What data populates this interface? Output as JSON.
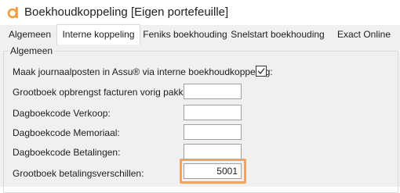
{
  "window": {
    "title": "Boekhoudkoppeling [Eigen portefeuille]"
  },
  "tabs": [
    {
      "label": "Algemeen"
    },
    {
      "label": "Interne koppeling"
    },
    {
      "label": "Feniks boekhouding"
    },
    {
      "label": "Snelstart boekhouding"
    },
    {
      "label": "Exact Online"
    }
  ],
  "group": {
    "label": "Algemeen"
  },
  "fields": {
    "journal_checkbox": {
      "label": "Maak journaalposten in Assu® via interne boekhoudkoppeling:",
      "checked": true
    },
    "grootboek_opbrengst": {
      "label": "Grootboek opbrengst facturen vorig pakket:",
      "value": ""
    },
    "dagboek_verkoop": {
      "label": "Dagboekcode Verkoop:",
      "value": ""
    },
    "dagboek_memoriaal": {
      "label": "Dagboekcode Memoriaal:",
      "value": ""
    },
    "dagboek_betalingen": {
      "label": "Dagboekcode Betalingen:",
      "value": ""
    },
    "grootboek_betalingsverschillen": {
      "label": "Grootboek betalingsverschillen:",
      "value": "5001"
    }
  },
  "colors": {
    "highlight": "#f5a25d",
    "app_icon": "#f39c3d"
  }
}
